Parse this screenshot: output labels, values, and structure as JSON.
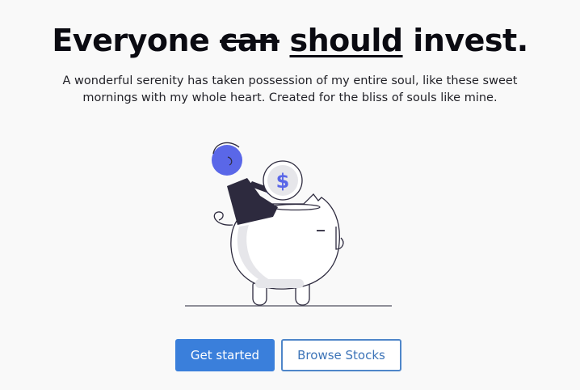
{
  "hero": {
    "headline": {
      "prefix": "Everyone ",
      "struck_word": "can",
      "underlined_word": "should",
      "suffix": " invest."
    },
    "subtitle": "A wonderful serenity has taken possession of my entire soul, like these sweet mornings with my whole heart. Created for the bliss of souls like mine.",
    "illustration": {
      "icon": "piggy-bank-person-coin-illustration",
      "coin_symbol": "$"
    },
    "buttons": {
      "primary_label": "Get started",
      "secondary_label": "Browse Stocks"
    }
  },
  "colors": {
    "primary": "#3a7fdb",
    "secondary_border": "#4f86c9",
    "accent_illustration": "#5a67e8",
    "dark_figure": "#2d2a3e",
    "background": "#f9f9f9"
  }
}
